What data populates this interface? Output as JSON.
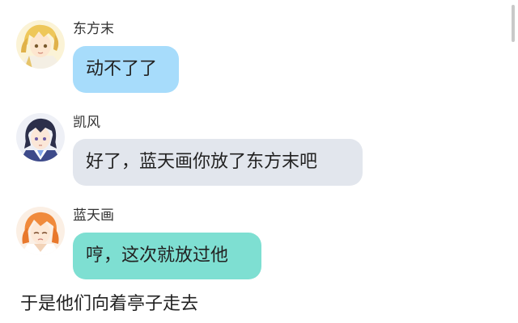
{
  "messages": [
    {
      "sender": "东方末",
      "text": "动不了了",
      "avatar": "blond-character-avatar",
      "bubble_color": "#a7dcfb"
    },
    {
      "sender": "凯风",
      "text": "好了，蓝天画你放了东方末吧",
      "avatar": "dark-haired-character-avatar",
      "bubble_color": "#e2e6ed"
    },
    {
      "sender": "蓝天画",
      "text": "哼，这次就放过他",
      "avatar": "orange-haired-character-avatar",
      "bubble_color": "#7edfd2"
    }
  ],
  "narration": "于是他们向着亭子走去"
}
